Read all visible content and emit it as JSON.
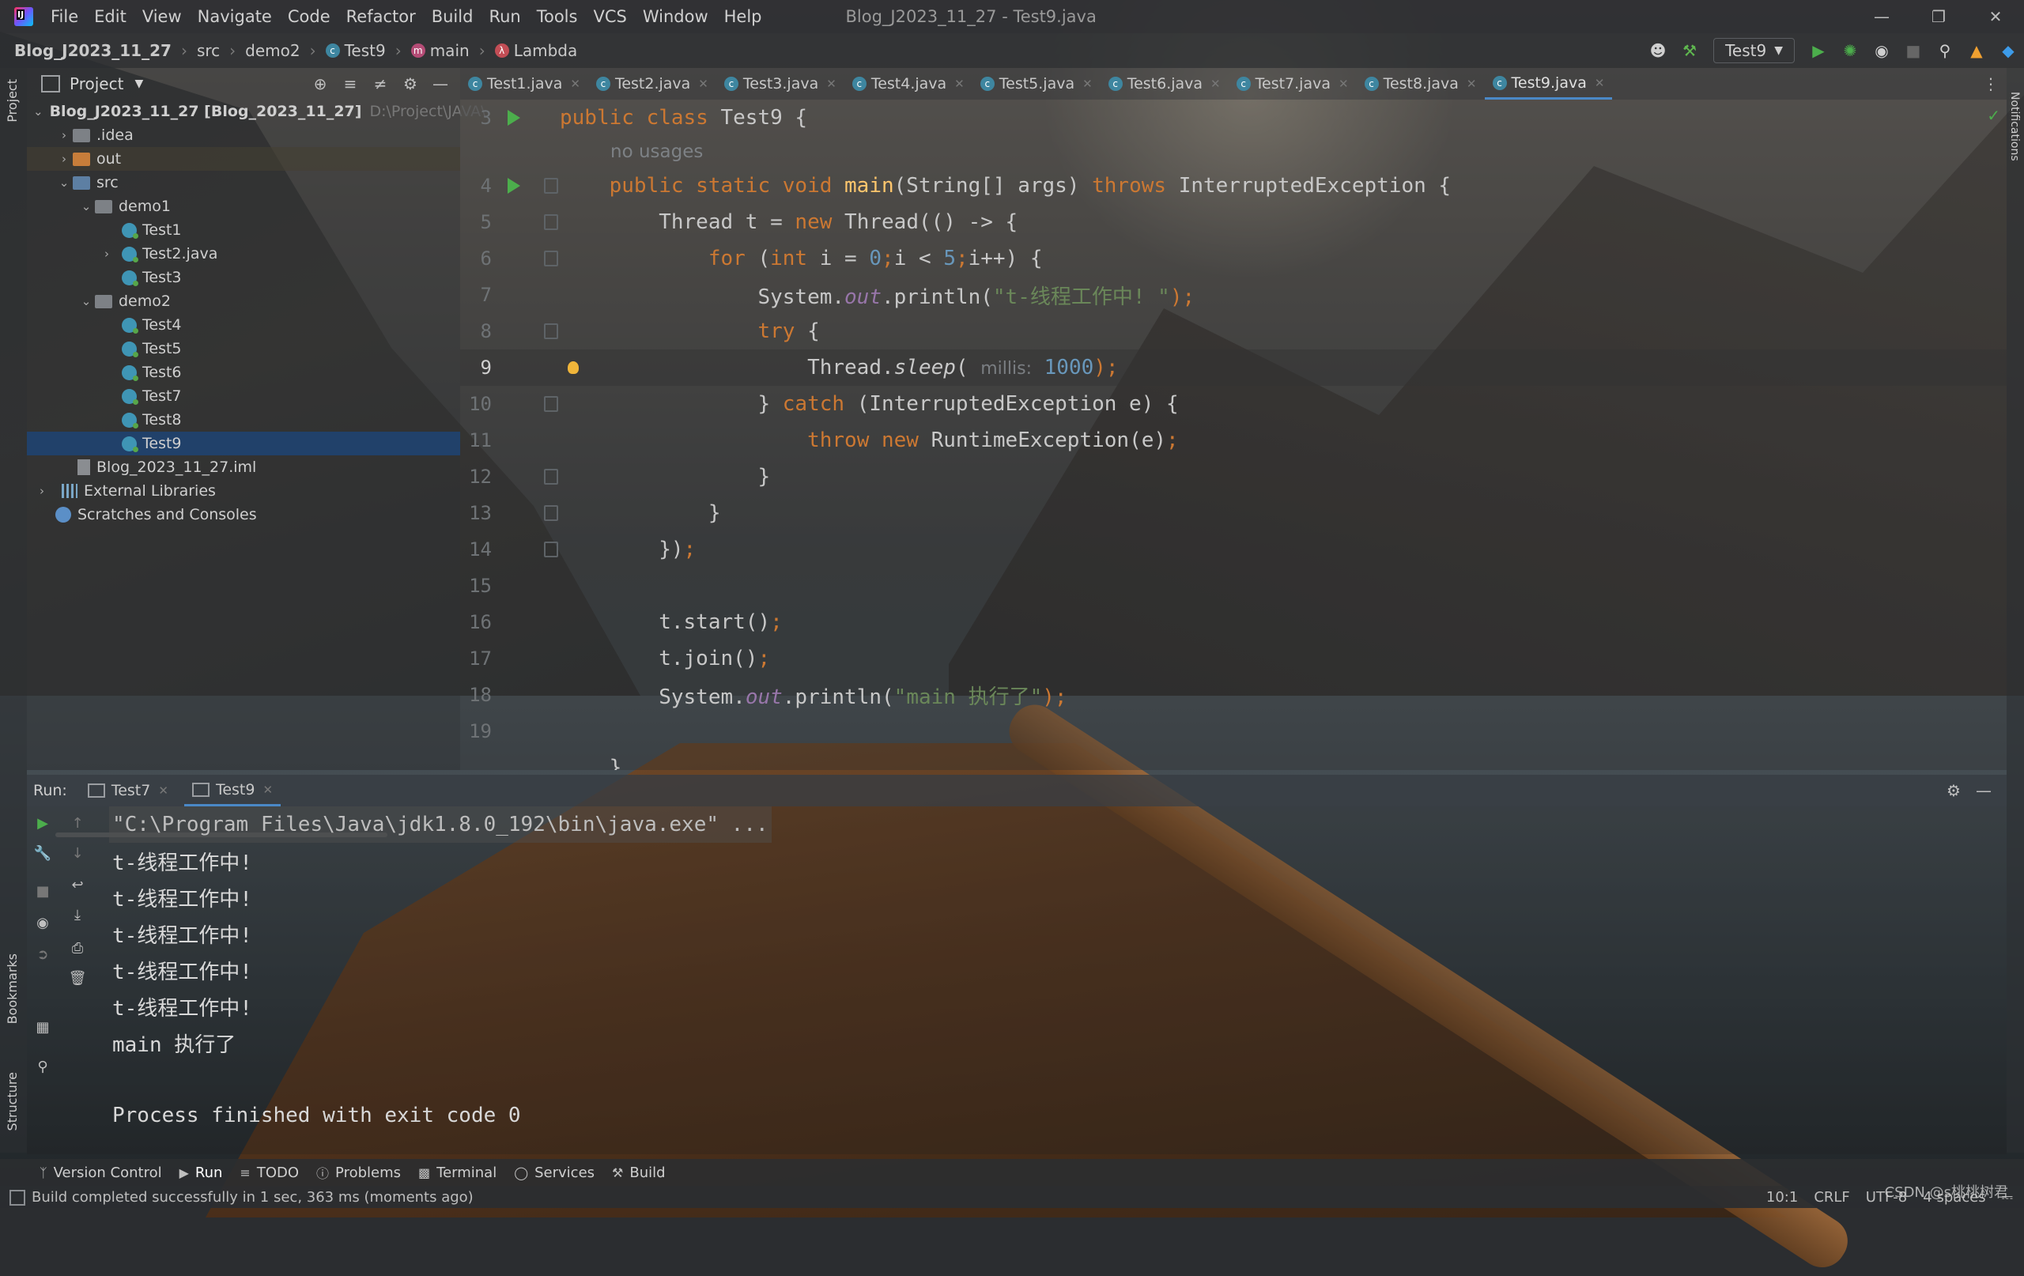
{
  "menu": {
    "items": [
      "File",
      "Edit",
      "View",
      "Navigate",
      "Code",
      "Refactor",
      "Build",
      "Run",
      "Tools",
      "VCS",
      "Window",
      "Help"
    ],
    "window_title": "Blog_J2023_11_27 - Test9.java"
  },
  "breadcrumb": {
    "project": "Blog_J2023_11_27",
    "items": [
      "src",
      "demo2",
      "Test9",
      "main",
      "Lambda"
    ]
  },
  "run_config": {
    "label": "Test9"
  },
  "project_panel": {
    "title": "Project",
    "root_label": "Blog_J2023_11_27 [Blog_2023_11_27]",
    "root_path": "D:\\Project\\JAVA\\",
    "tree": [
      "Blog_J2023_11_27 [Blog_2023_11_27]",
      ".idea",
      "out",
      "src",
      "demo1",
      "Test1",
      "Test2.java",
      "Test3",
      "demo2",
      "Test4",
      "Test5",
      "Test6",
      "Test7",
      "Test8",
      "Test9",
      "Blog_2023_11_27.iml",
      "External Libraries",
      "Scratches and Consoles"
    ]
  },
  "editor_tabs": [
    "Test1.java",
    "Test2.java",
    "Test3.java",
    "Test4.java",
    "Test5.java",
    "Test6.java",
    "Test7.java",
    "Test8.java",
    "Test9.java"
  ],
  "editor": {
    "line_numbers": [
      "3",
      "4",
      "5",
      "6",
      "7",
      "8",
      "9",
      "10",
      "11",
      "12",
      "13",
      "14",
      "15",
      "16",
      "17",
      "18",
      "19"
    ],
    "usage_hint": "no usages",
    "param_hint": "millis:",
    "current_line": "9",
    "lines": {
      "l3a": "public class ",
      "l3b": "Test9 {",
      "l4a": "    public static void ",
      "l4b": "main",
      "l4c": "(String[] args) ",
      "l4d": "throws ",
      "l4e": "InterruptedException {",
      "l5a": "        Thread t = ",
      "l5b": "new ",
      "l5c": "Thread(() -> {",
      "l6a": "            ",
      "l6b": "for ",
      "l6c": "(",
      "l6d": "int ",
      "l6e": "i = ",
      "l6f": "0",
      "l6g": ";",
      "l6h": "i < ",
      "l6i": "5",
      "l6j": ";",
      "l6k": "i++) {",
      "l7a": "                System.",
      "l7b": "out",
      "l7c": ".println(",
      "l7d": "\"t-线程工作中! \"",
      "l7e": ");",
      "l8a": "                ",
      "l8b": "try",
      "l8c": " {",
      "l9a": "                    Thread.",
      "l9b": "sleep",
      "l9c": "( ",
      "l9d": "millis:",
      "l9e": " 1000",
      "l9f": ");",
      "l10a": "                } ",
      "l10b": "catch ",
      "l10c": "(InterruptedException e) {",
      "l11a": "                    ",
      "l11b": "throw new ",
      "l11c": "RuntimeException(e)",
      "l11d": ";",
      "l12a": "                }",
      "l13a": "            }",
      "l14a": "        })",
      "l14b": ";",
      "l16a": "        t.start()",
      "l16b": ";",
      "l17a": "        t.join()",
      "l17b": ";",
      "l18a": "        System.",
      "l18b": "out",
      "l18c": ".println(",
      "l18d": "\"main 执行了\"",
      "l18e": ");",
      "l20a": "    }"
    }
  },
  "run_panel": {
    "title": "Run:",
    "tabs": [
      "Test7",
      "Test9"
    ],
    "console": [
      "\"C:\\Program Files\\Java\\jdk1.8.0_192\\bin\\java.exe\" ...",
      "t-线程工作中!",
      "t-线程工作中!",
      "t-线程工作中!",
      "t-线程工作中!",
      "t-线程工作中!",
      "main 执行了",
      "",
      "Process finished with exit code 0"
    ]
  },
  "tool_windows": [
    "Version Control",
    "Run",
    "TODO",
    "Problems",
    "Terminal",
    "Services",
    "Build"
  ],
  "side_labels": {
    "project": "Project",
    "bookmarks": "Bookmarks",
    "structure": "Structure",
    "notifications": "Notifications"
  },
  "status": {
    "message": "Build completed successfully in 1 sec, 363 ms (moments ago)",
    "position": "10:1",
    "line_sep": "CRLF",
    "encoding": "UTF-8",
    "indent": "4 spaces"
  },
  "watermark": "CSDN @s桃桃树君"
}
